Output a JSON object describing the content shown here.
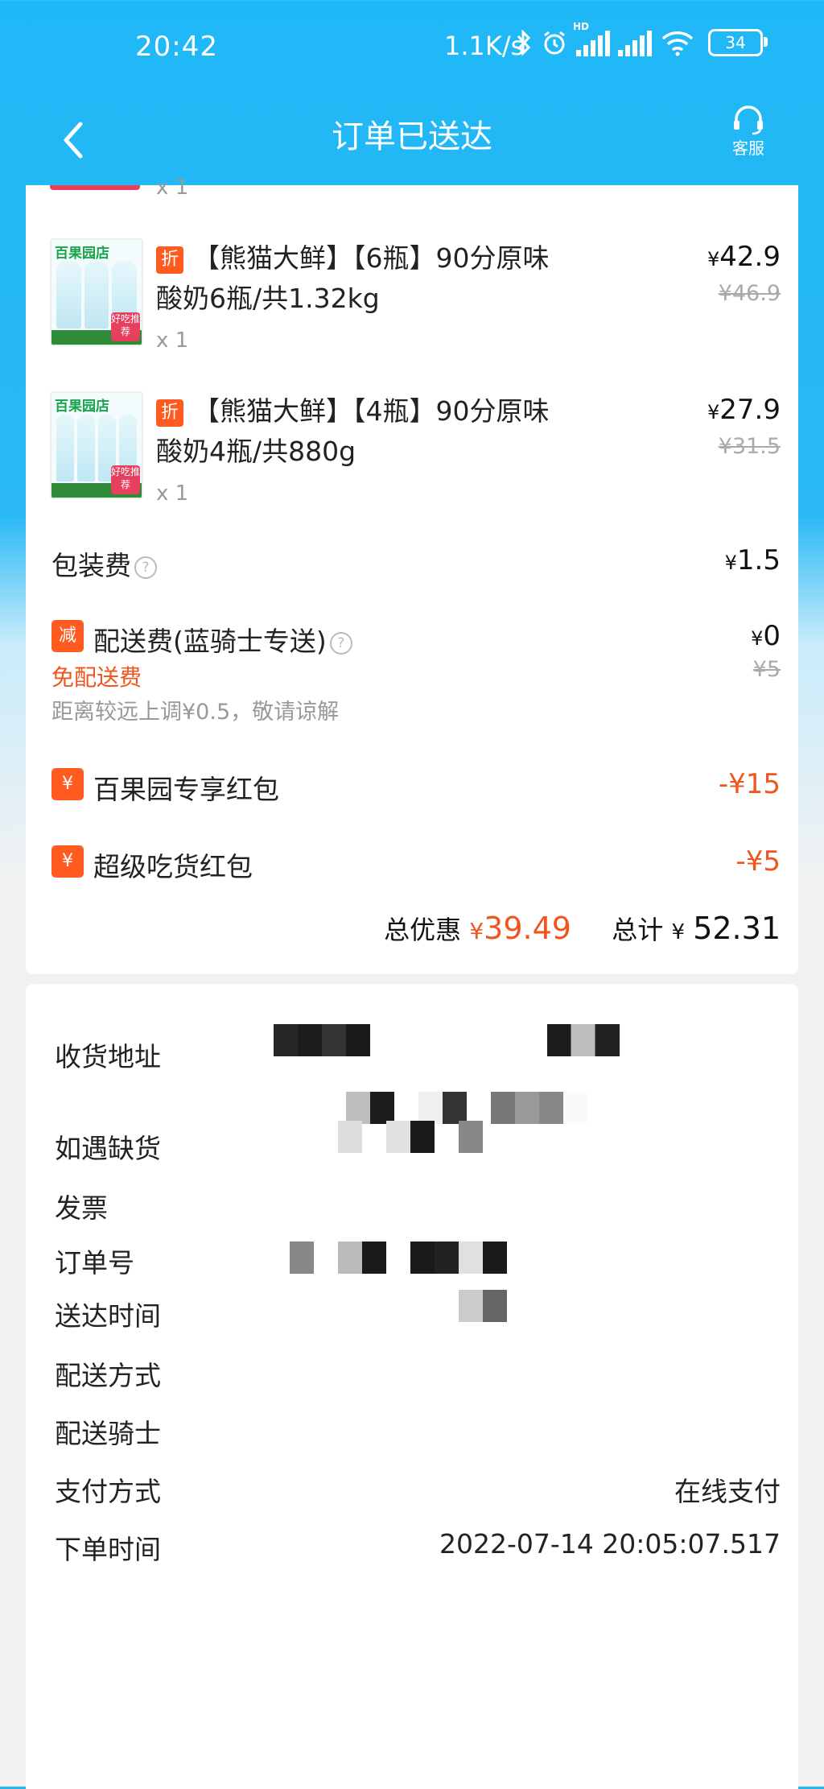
{
  "status_bar": {
    "time": "20:42",
    "net_speed": "1.1K/s",
    "hd": "HD",
    "battery": "34"
  },
  "nav": {
    "title": "订单已送达",
    "customer_service": "客服"
  },
  "top_qty": "x 1",
  "products": [
    {
      "brand": "百果园店",
      "tag": "好吃推荐",
      "badge": "折",
      "name": "【熊猫大鲜】【6瓶】90分原味酸奶6瓶/共1.32kg",
      "qty": "x 1",
      "price_symbol": "¥",
      "price": "42.9",
      "original_price": "¥46.9"
    },
    {
      "brand": "百果园店",
      "tag": "好吃推荐",
      "badge": "折",
      "name": "【熊猫大鲜】【4瓶】90分原味酸奶4瓶/共880g",
      "qty": "x 1",
      "price_symbol": "¥",
      "price": "27.9",
      "original_price": "¥31.5"
    }
  ],
  "packaging": {
    "label": "包装费",
    "help": "?",
    "symbol": "¥",
    "value": "1.5"
  },
  "delivery": {
    "badge": "减",
    "label": "配送费(蓝骑士专送)",
    "help": "?",
    "symbol": "¥",
    "value": "0",
    "original": "¥5",
    "free_note": "免配送费",
    "distance_note": "距离较远上调¥0.5，敬请谅解"
  },
  "coupons": [
    {
      "badge": "¥",
      "label": "百果园专享红包",
      "value": "-¥15"
    },
    {
      "badge": "¥",
      "label": "超级吃货红包",
      "value": "-¥5"
    }
  ],
  "summary": {
    "discount_label": "总优惠",
    "discount_symbol": "¥",
    "discount_value": "39.49",
    "total_label": "总计",
    "total_symbol": "¥",
    "total_value": "52.31"
  },
  "info": {
    "address_label": "收货地址",
    "out_of_stock_label": "如遇缺货",
    "invoice_label": "发票",
    "order_no_label": "订单号",
    "delivered_time_label": "送达时间",
    "delivery_method_label": "配送方式",
    "rider_label": "配送骑士",
    "payment_label": "支付方式",
    "payment_value": "在线支付",
    "order_time_label": "下单时间",
    "order_time_value": "2022-07-14 20:05:07.517"
  },
  "colors": {
    "accent": "#1fb8f7",
    "discount": "#f0541f",
    "badge": "#ff5a20"
  }
}
